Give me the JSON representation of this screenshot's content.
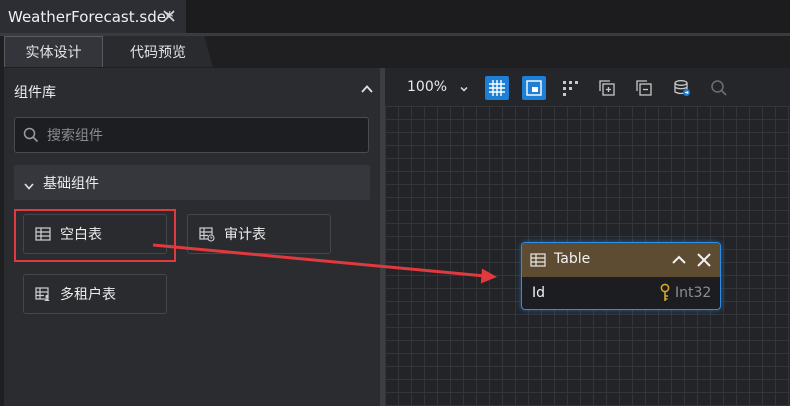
{
  "file_tab": {
    "title": "WeatherForecast.sde*"
  },
  "view_tabs": [
    {
      "label": "实体设计",
      "active": true
    },
    {
      "label": "代码预览",
      "active": false
    }
  ],
  "left_panel": {
    "title": "组件库",
    "search_placeholder": "搜索组件",
    "group": {
      "label": "基础组件",
      "items": [
        {
          "label": "空白表",
          "icon": "table-icon",
          "highlighted": true
        },
        {
          "label": "审计表",
          "icon": "audit-table-icon"
        },
        {
          "label": "多租户表",
          "icon": "tenant-table-icon"
        }
      ]
    }
  },
  "toolbar": {
    "zoom": "100%",
    "buttons": [
      {
        "name": "grid-toggle-icon",
        "active": true
      },
      {
        "name": "snap-toggle-icon",
        "active": true
      },
      {
        "name": "layout-dots-icon",
        "active": false
      },
      {
        "name": "expand-all-icon",
        "active": false
      },
      {
        "name": "collapse-all-icon",
        "active": false
      },
      {
        "name": "database-sync-icon",
        "active": false
      },
      {
        "name": "search-icon",
        "active": false
      }
    ]
  },
  "table_node": {
    "name": "Table",
    "fields": [
      {
        "name": "Id",
        "type": "Int32",
        "primary_key": true
      }
    ]
  },
  "colors": {
    "accent": "#1e7fd6",
    "highlight_red": "#e0393e",
    "node_header": "#5d4c32",
    "node_border": "#2f8de4"
  }
}
